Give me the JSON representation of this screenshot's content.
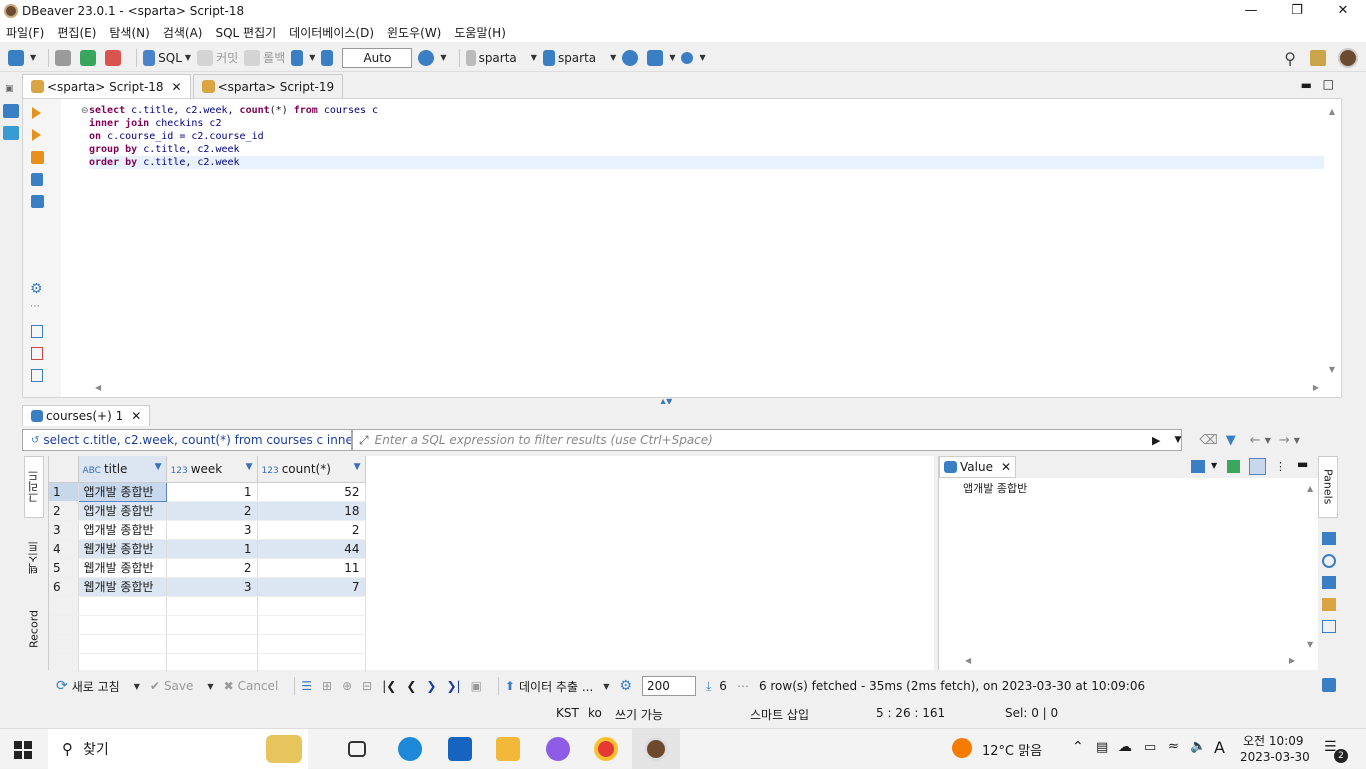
{
  "window": {
    "title": "DBeaver 23.0.1 - <sparta> Script-18"
  },
  "menu": [
    "파일(F)",
    "편집(E)",
    "탐색(N)",
    "검색(A)",
    "SQL 편집기",
    "데이터베이스(D)",
    "윈도우(W)",
    "도움말(H)"
  ],
  "toolbar": {
    "sql_label": "SQL",
    "commit_label": "커밋",
    "rollback_label": "롤백",
    "mode_value": "Auto",
    "datasource": "sparta",
    "schema": "sparta"
  },
  "editor_tabs": [
    {
      "label": "<sparta> Script-18",
      "active": true
    },
    {
      "label": "<sparta> Script-19",
      "active": false
    }
  ],
  "sql_lines": [
    "select c.title, c2.week, count(*) from courses c",
    "inner join checkins c2",
    "on c.course_id = c2.course_id",
    "group by c.title, c2.week",
    "order by c.title, c2.week"
  ],
  "results": {
    "tab_label": "courses(+) 1",
    "query_text": "select c.title, c2.week, count(*) from courses c inner join",
    "filter_placeholder": "Enter a SQL expression to filter results (use Ctrl+Space)",
    "vertical_tabs": [
      "그리드",
      "텍스트",
      "Record"
    ],
    "columns": [
      {
        "type": "ABC",
        "name": "title"
      },
      {
        "type": "123",
        "name": "week"
      },
      {
        "type": "123",
        "name": "count(*)"
      }
    ],
    "rows": [
      [
        "1",
        "앱개발 종합반",
        "1",
        "52"
      ],
      [
        "2",
        "앱개발 종합반",
        "2",
        "18"
      ],
      [
        "3",
        "앱개발 종합반",
        "3",
        "2"
      ],
      [
        "4",
        "웹개발 종합반",
        "1",
        "44"
      ],
      [
        "5",
        "웹개발 종합반",
        "2",
        "11"
      ],
      [
        "6",
        "웹개발 종합반",
        "3",
        "7"
      ]
    ]
  },
  "value_panel": {
    "tab_label": "Value",
    "content": "앱개발 종합반",
    "side_label": "Panels"
  },
  "bottom": {
    "refresh_label": "새로 고침",
    "save_label": "Save",
    "cancel_label": "Cancel",
    "export_label": "데이터 추출 ...",
    "fetch_size": "200",
    "row_count": "6",
    "fetch_status": "6 row(s) fetched - 35ms (2ms fetch), on 2023-03-30 at 10:09:06"
  },
  "status": {
    "tz": "KST",
    "locale": "ko",
    "mode": "쓰기 가능",
    "insert": "스마트 삽입",
    "pos": "5 : 26 : 161",
    "sel": "Sel: 0 | 0"
  },
  "taskbar": {
    "search": "찾기",
    "weather": "12°C  맑음",
    "ime": "A",
    "time": "오전 10:09",
    "date": "2023-03-30",
    "notify_count": "2"
  }
}
